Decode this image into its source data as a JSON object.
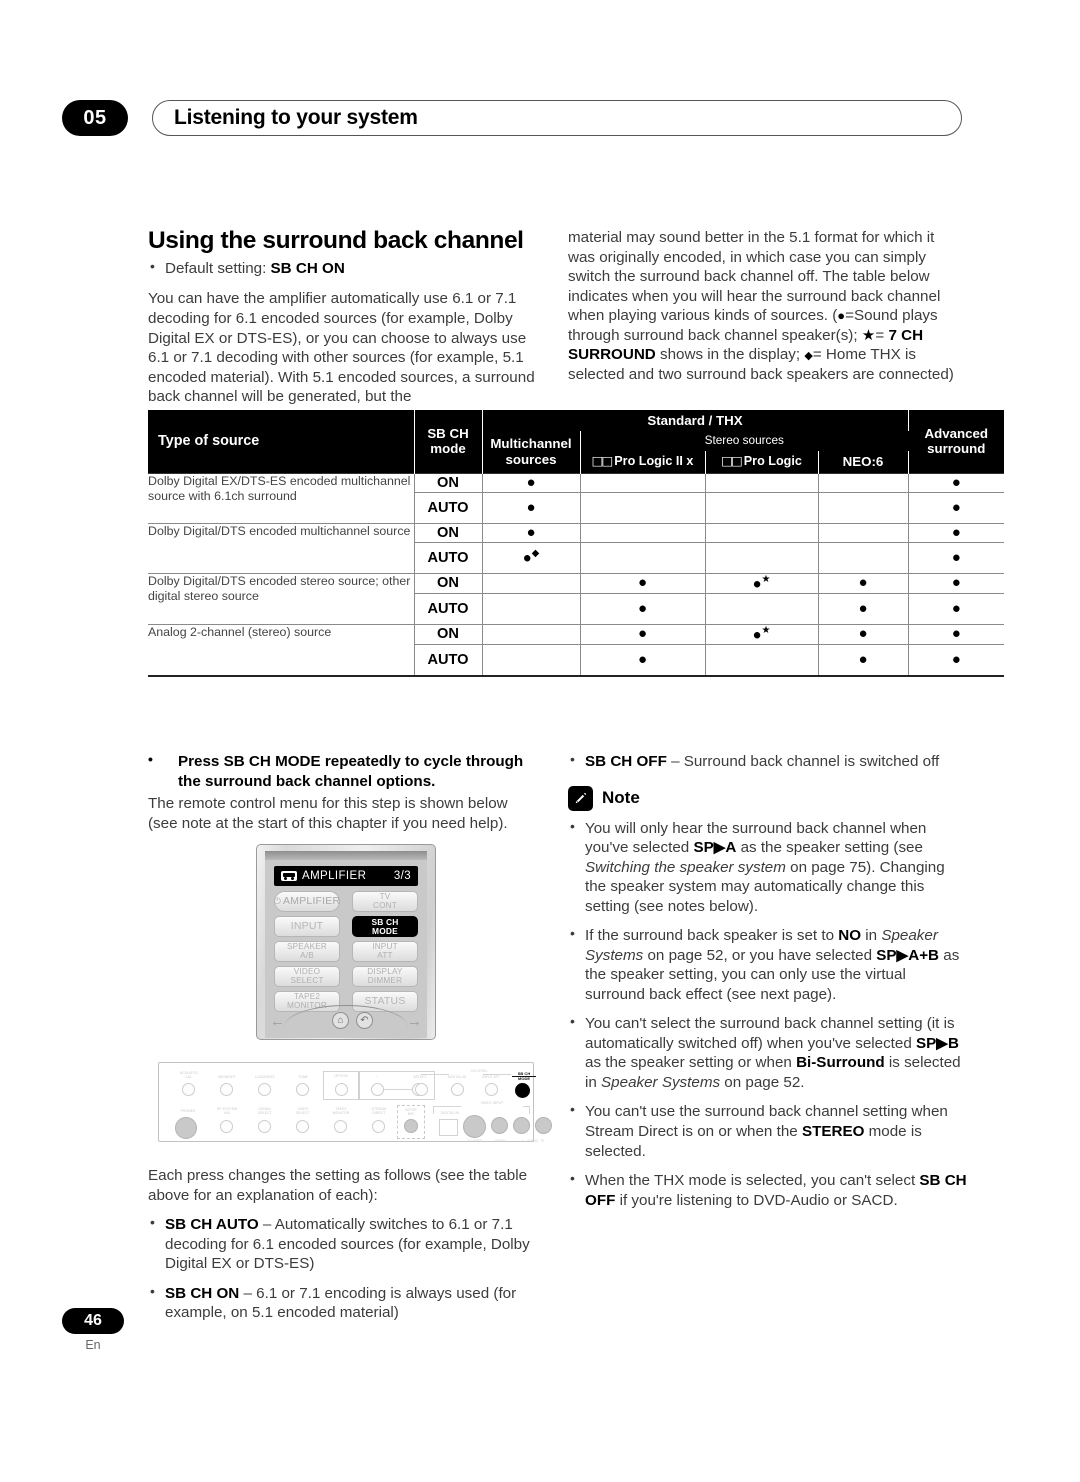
{
  "header": {
    "chapter_number": "05",
    "chapter_title": "Listening to your system"
  },
  "section": {
    "title": "Using the surround back channel",
    "default_setting_bullet": "Default setting: ",
    "default_setting_value": "SB CH ON",
    "intro_left": "You can have the amplifier automatically use 6.1 or 7.1 decoding for 6.1 encoded sources (for example, Dolby Digital EX or DTS-ES), or you can choose to always use 6.1 or 7.1 decoding with other sources (for example, 5.1 encoded material). With 5.1 encoded sources, a surround back channel will be generated, but the",
    "intro_right_1": "material may sound better in the 5.1 format for which it was originally encoded, in which case you can simply switch the surround back channel off. The table below indicates when you will hear the surround back channel when playing various kinds of sources. (",
    "intro_right_2": "=Sound plays through surround back channel speaker(s); ",
    "intro_right_3": "= ",
    "intro_right_bold_1": "7 CH SURROUND",
    "intro_right_4": " shows in the display; ",
    "intro_right_5": "= Home THX is selected and two surround back speakers are connected)",
    "symbol_dot": "●",
    "symbol_star": "★",
    "symbol_diamond": "◆"
  },
  "table": {
    "headers": {
      "type_of_source": "Type of source",
      "sb_ch_mode_line1": "SB CH",
      "sb_ch_mode_line2": "mode",
      "standard_thx": "Standard / THX",
      "multichannel_line1": "Multichannel",
      "multichannel_line2": "sources",
      "stereo_sources": "Stereo sources",
      "pro_logic_iix": "Pro Logic II x",
      "pro_logic": "Pro Logic",
      "neo6": "NEO:6",
      "advanced_line1": "Advanced",
      "advanced_line2": "surround",
      "dolby_mark": "□□"
    },
    "rows": [
      {
        "source": "Dolby Digital EX/DTS-ES encoded multichannel source with 6.1ch surround",
        "rowspan": 2,
        "modes": [
          {
            "mode": "ON",
            "multichannel": "dot",
            "plii": "",
            "pl": "",
            "neo6": "",
            "advanced": "dot"
          },
          {
            "mode": "AUTO",
            "multichannel": "dot",
            "plii": "",
            "pl": "",
            "neo6": "",
            "advanced": "dot"
          }
        ]
      },
      {
        "source": "Dolby Digital/DTS encoded multichannel source",
        "rowspan": 2,
        "modes": [
          {
            "mode": "ON",
            "multichannel": "dot",
            "plii": "",
            "pl": "",
            "neo6": "",
            "advanced": "dot"
          },
          {
            "mode": "AUTO",
            "multichannel": "dot-diamond",
            "plii": "",
            "pl": "",
            "neo6": "",
            "advanced": "dot"
          }
        ]
      },
      {
        "source": "Dolby Digital/DTS encoded stereo source; other digital stereo source",
        "rowspan": 2,
        "modes": [
          {
            "mode": "ON",
            "multichannel": "",
            "plii": "dot",
            "pl": "dot-star",
            "neo6": "dot",
            "advanced": "dot"
          },
          {
            "mode": "AUTO",
            "multichannel": "",
            "plii": "dot",
            "pl": "",
            "neo6": "dot",
            "advanced": "dot"
          }
        ]
      },
      {
        "source": "Analog 2-channel (stereo) source",
        "rowspan": 2,
        "modes": [
          {
            "mode": "ON",
            "multichannel": "",
            "plii": "dot",
            "pl": "dot-star",
            "neo6": "dot",
            "advanced": "dot"
          },
          {
            "mode": "AUTO",
            "multichannel": "",
            "plii": "dot",
            "pl": "",
            "neo6": "dot",
            "advanced": "dot"
          }
        ]
      }
    ]
  },
  "press_instruction": {
    "bullet_bold": "Press SB CH MODE repeatedly to cycle through the surround back channel options.",
    "body": "The remote control menu for this step is shown below (see note at the start of this chapter if you need help)."
  },
  "remote": {
    "lcd_title": "AMPLIFIER",
    "lcd_page": "3/3",
    "lcd_icon": "remote-device-icon",
    "buttons": [
      {
        "label": "AMPLIFIER",
        "power": true,
        "highlight": false,
        "style": "pill"
      },
      {
        "label": "TV\nCONT",
        "power": false,
        "highlight": false,
        "style": "normal"
      },
      {
        "label": "INPUT",
        "power": false,
        "highlight": false,
        "style": "big"
      },
      {
        "label": "SB CH\nMODE",
        "power": false,
        "highlight": true,
        "style": "normal"
      },
      {
        "label": "SPEAKER\nA/B",
        "power": false,
        "highlight": false,
        "style": "normal"
      },
      {
        "label": "INPUT\nATT",
        "power": false,
        "highlight": false,
        "style": "normal"
      },
      {
        "label": "VIDEO\nSELECT",
        "power": false,
        "highlight": false,
        "style": "normal"
      },
      {
        "label": "DISPLAY\nDIMMER",
        "power": false,
        "highlight": false,
        "style": "normal"
      },
      {
        "label": "TAPE2\nMONITOR",
        "power": false,
        "highlight": false,
        "style": "normal"
      },
      {
        "label": "STATUS",
        "power": false,
        "highlight": false,
        "style": "big"
      }
    ],
    "nav": {
      "left_arrow": "←",
      "right_arrow": "→",
      "home_icon": "home-icon",
      "back_icon": "return-icon"
    }
  },
  "panel": {
    "top_labels": [
      "ACOUSTIC\nCAL.",
      "MIDNIGHT",
      "LOUDNESS",
      "TONE",
      "OPTION",
      "–",
      "+",
      "DIGITAL IN",
      "INPUT ATT",
      "SELECT",
      "–",
      "+"
    ],
    "bottom_labels": [
      "PHONES",
      "SP SYSTEM\nA/B",
      "SIGNAL\nSELECT",
      "VIDEO\nSELECT",
      "TAPE2\nMONITOR",
      "STREAM\nDIRECT",
      "SETUP\nMIC",
      "DIGITAL IN"
    ],
    "group_labels": [
      "CH LEVEL",
      "VIDEO INPUT"
    ],
    "jack_labels": [
      "S-VIDEO",
      "VIDEO",
      "L",
      "AUDIO",
      "R"
    ],
    "highlight_button": "SB CH\nMODE",
    "highlight_line1": "SB CH",
    "highlight_line2": "MODE"
  },
  "each_press": {
    "body": "Each press changes the setting as follows (see the table above for an explanation of each):",
    "items": [
      {
        "bold": "SB CH AUTO",
        "rest": " – Automatically switches to 6.1 or 7.1 decoding for 6.1 encoded sources (for example, Dolby Digital EX or DTS-ES)"
      },
      {
        "bold": "SB CH ON",
        "rest": " – 6.1 or 7.1 encoding is always used (for example, on 5.1 encoded material)"
      }
    ],
    "off_item": {
      "bold": "SB CH OFF",
      "rest": " – Surround back channel is switched off"
    }
  },
  "note": {
    "label": "Note",
    "icon": "pencil-note-icon",
    "items": [
      {
        "parts": [
          {
            "t": "You will only hear the surround back channel when you've selected ",
            "s": "n"
          },
          {
            "t": "SP▶A",
            "s": "b"
          },
          {
            "t": " as the speaker setting (see ",
            "s": "n"
          },
          {
            "t": "Switching the speaker system",
            "s": "i"
          },
          {
            "t": " on page 75). Changing the speaker system may automatically change this setting (see notes below).",
            "s": "n"
          }
        ]
      },
      {
        "parts": [
          {
            "t": "If the surround back speaker is set to ",
            "s": "n"
          },
          {
            "t": "NO",
            "s": "b"
          },
          {
            "t": " in ",
            "s": "n"
          },
          {
            "t": "Speaker Systems",
            "s": "i"
          },
          {
            "t": " on page 52, or you have selected ",
            "s": "n"
          },
          {
            "t": "SP▶A+B",
            "s": "b"
          },
          {
            "t": " as the speaker setting, you can only use the virtual surround back effect (see next page).",
            "s": "n"
          }
        ]
      },
      {
        "parts": [
          {
            "t": "You can't select the surround back channel setting (it is automatically switched off) when you've selected ",
            "s": "n"
          },
          {
            "t": "SP▶B",
            "s": "b"
          },
          {
            "t": " as the speaker setting or when ",
            "s": "n"
          },
          {
            "t": "Bi-Surround",
            "s": "b"
          },
          {
            "t": " is selected in ",
            "s": "n"
          },
          {
            "t": "Speaker Systems",
            "s": "i"
          },
          {
            "t": " on page 52.",
            "s": "n"
          }
        ]
      },
      {
        "parts": [
          {
            "t": "You can't use the surround back channel setting when Stream Direct is on or when the ",
            "s": "n"
          },
          {
            "t": "STEREO",
            "s": "b"
          },
          {
            "t": " mode is selected.",
            "s": "n"
          }
        ]
      },
      {
        "parts": [
          {
            "t": "When the THX mode is selected, you can't select ",
            "s": "n"
          },
          {
            "t": "SB CH OFF",
            "s": "b"
          },
          {
            "t": " if you're listening to DVD-Audio or SACD.",
            "s": "n"
          }
        ]
      }
    ]
  },
  "footer": {
    "page_number": "46",
    "language": "En"
  }
}
